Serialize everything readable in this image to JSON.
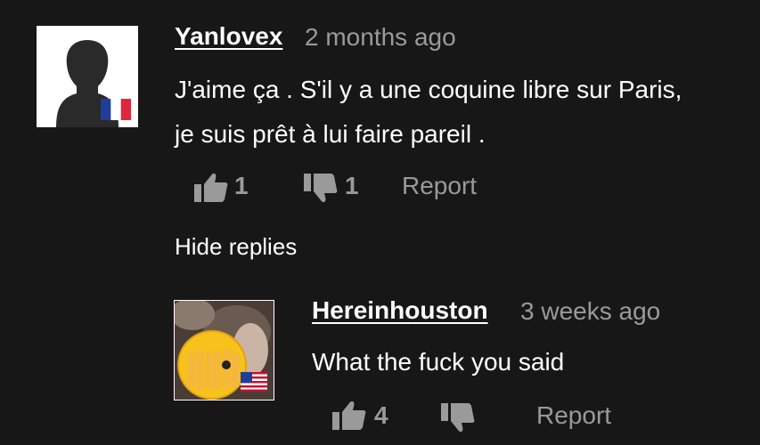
{
  "comment": {
    "author": "Yanlovex",
    "time": "2 months ago",
    "text": "J'aime ça . S'il y a une coquine libre sur Paris, je suis prêt à lui faire pareil .",
    "likes": "1",
    "dislikes": "1",
    "report_label": "Report",
    "avatar_icon": "default-user-silhouette-icon",
    "flag_icon": "france-flag-icon"
  },
  "hide_replies_label": "Hide replies",
  "reply": {
    "author": "Hereinhouston",
    "time": "3 weeks ago",
    "text": "What the fuck you said",
    "likes": "4",
    "dislikes": "",
    "report_label": "Report",
    "avatar_icon": "emoji-face-covering-eyes-avatar",
    "flag_icon": "usa-flag-icon"
  },
  "colors": {
    "background": "#171717",
    "text": "#ffffff",
    "muted": "#9a9a9a"
  }
}
